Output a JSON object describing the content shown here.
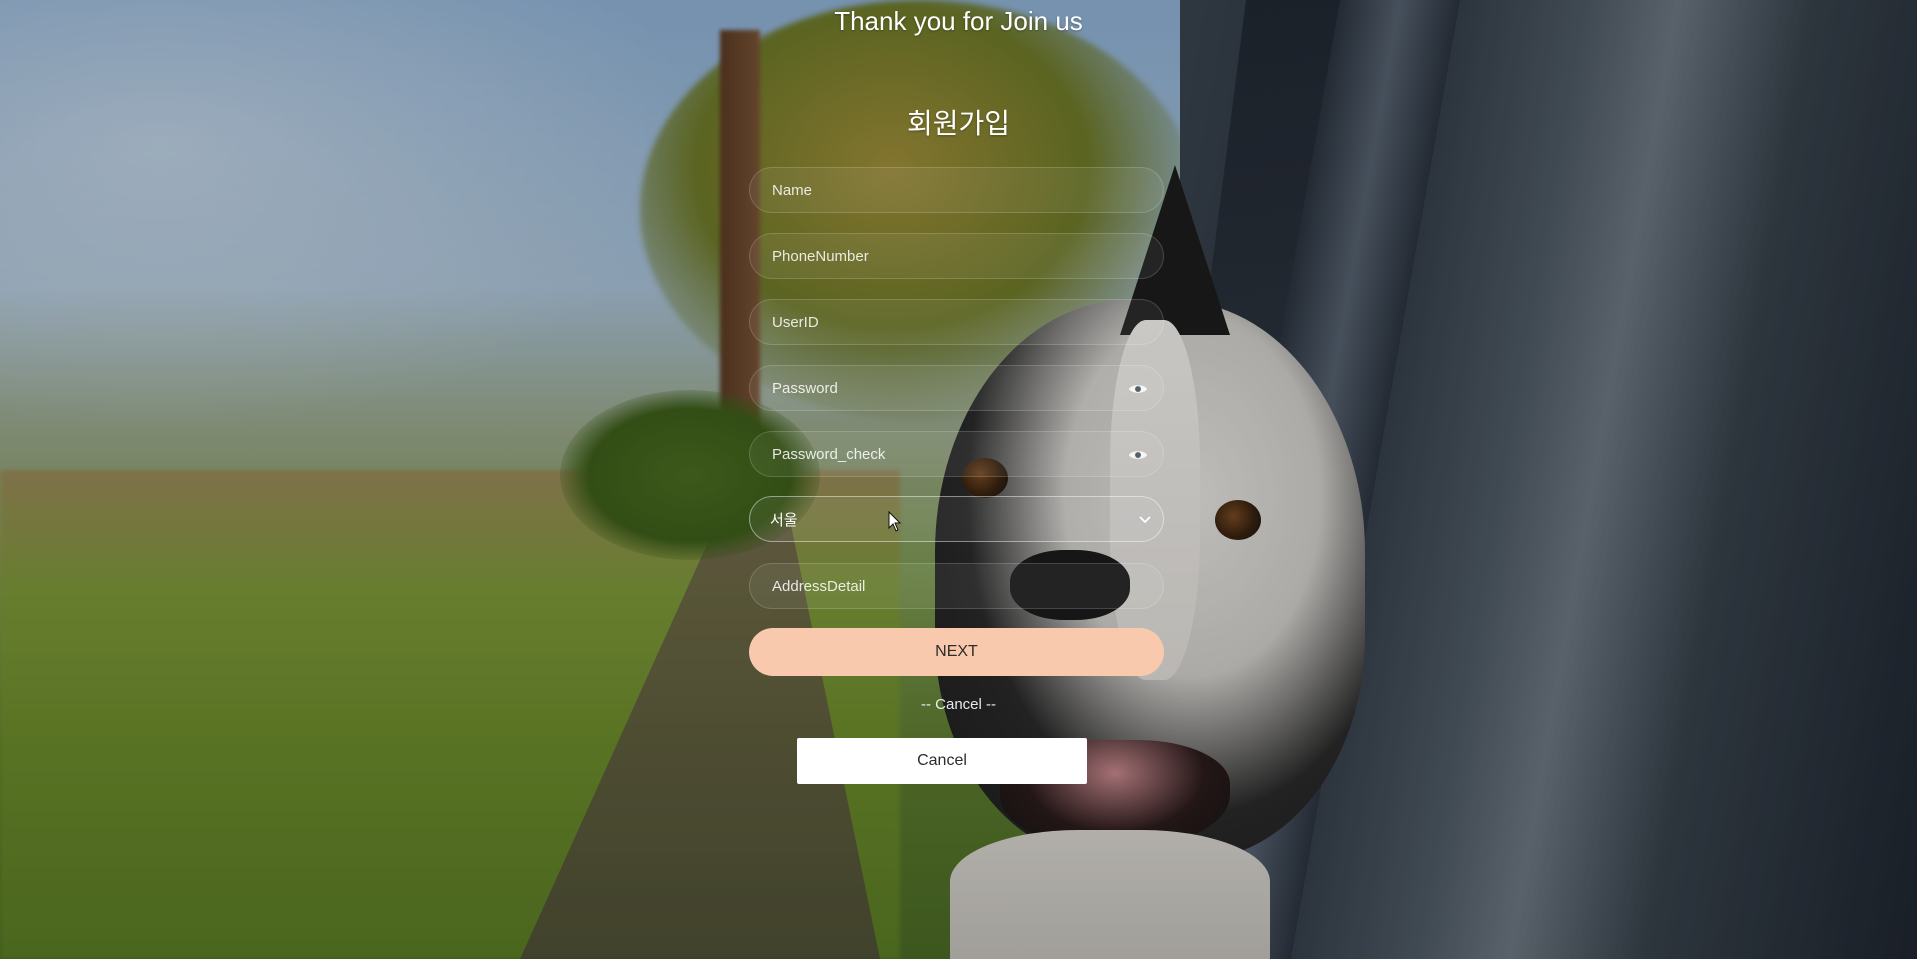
{
  "header": {
    "title": "Thank you for Join us"
  },
  "form": {
    "title": "회원가입",
    "name_placeholder": "Name",
    "phone_placeholder": "PhoneNumber",
    "userid_placeholder": "UserID",
    "password_placeholder": "Password",
    "password_check_placeholder": "Password_check",
    "region_selected": "서울",
    "address_detail_placeholder": "AddressDetail",
    "next_label": "NEXT",
    "divider_label": "-- Cancel --",
    "cancel_label": "Cancel"
  },
  "icons": {
    "password_toggle": "eye-icon",
    "password_check_toggle": "eye-icon",
    "region_dropdown": "chevron-down-icon"
  },
  "colors": {
    "next_button": "#f8c9ad",
    "cancel_button": "#ffffff",
    "text": "#ffffff"
  }
}
